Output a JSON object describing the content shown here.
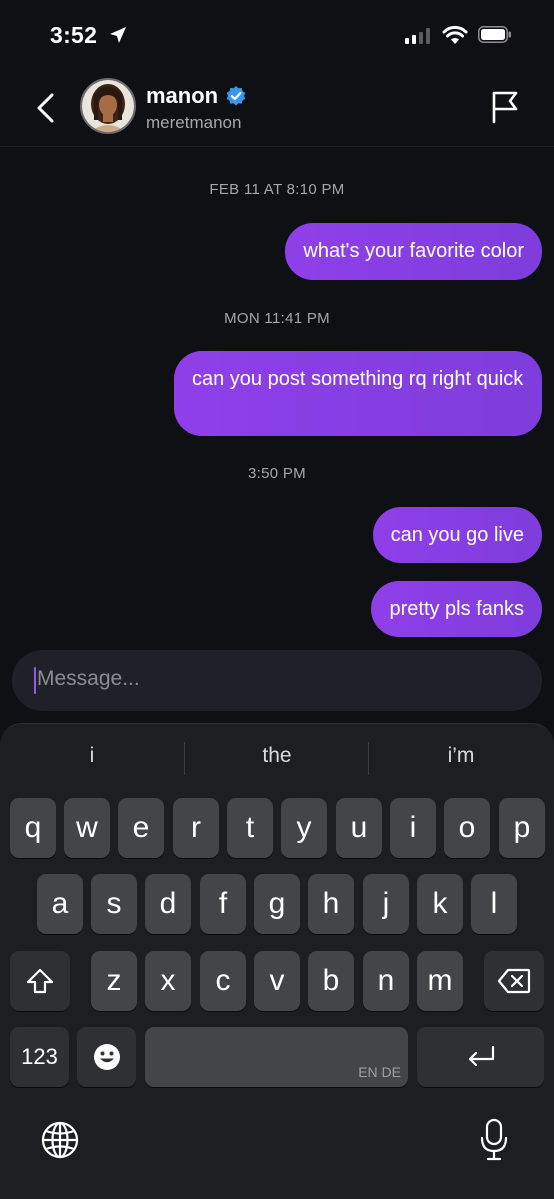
{
  "status_bar": {
    "time": "3:52",
    "icons": [
      "location-arrow-icon",
      "cellular-signal-icon",
      "wifi-icon",
      "battery-icon"
    ]
  },
  "header": {
    "name": "manon",
    "handle": "meretmanon",
    "verified": true,
    "icons": [
      "back-chevron-icon",
      "verified-badge-icon",
      "report-flag-icon"
    ]
  },
  "thread": {
    "items": [
      {
        "kind": "timestamp",
        "text": "FEB 11 AT 8:10 PM"
      },
      {
        "kind": "message",
        "text": "what's your favorite color"
      },
      {
        "kind": "timestamp",
        "text": "MON 11:41 PM"
      },
      {
        "kind": "message",
        "text": "can you post something rq right quick"
      },
      {
        "kind": "timestamp",
        "text": "3:50 PM"
      },
      {
        "kind": "message",
        "text": "can you go live"
      },
      {
        "kind": "message",
        "text": "pretty pls fanks"
      }
    ]
  },
  "composer": {
    "placeholder": "Message..."
  },
  "keyboard": {
    "suggestions": [
      "i",
      "the",
      "i’m"
    ],
    "row1": [
      "q",
      "w",
      "e",
      "r",
      "t",
      "y",
      "u",
      "i",
      "o",
      "p"
    ],
    "row2": [
      "a",
      "s",
      "d",
      "f",
      "g",
      "h",
      "j",
      "k",
      "l"
    ],
    "row3": [
      "z",
      "x",
      "c",
      "v",
      "b",
      "n",
      "m"
    ],
    "numbers_key": "123",
    "space_languages": "EN DE",
    "icons": [
      "shift-icon",
      "backspace-icon",
      "emoji-icon",
      "return-icon",
      "globe-icon",
      "microphone-icon"
    ]
  },
  "colors": {
    "background": "#0f1014",
    "bubble": "#8c3ee6",
    "keyboard": "#1d1e22",
    "key": "#444549",
    "verified": "#3897f0"
  }
}
